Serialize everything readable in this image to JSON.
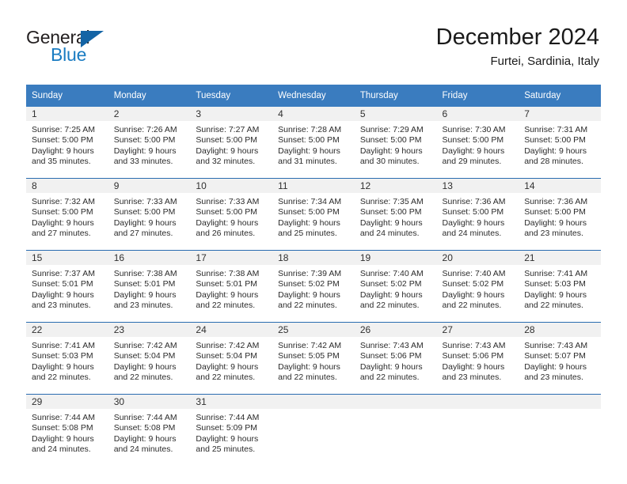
{
  "brand": {
    "name_top": "General",
    "name_bottom": "Blue",
    "accent_color": "#1a7cc2",
    "triangle_color": "#1464a5"
  },
  "header": {
    "title": "December 2024",
    "subtitle": "Furtei, Sardinia, Italy"
  },
  "theme": {
    "header_bg": "#3a7cbf",
    "header_text": "#ffffff",
    "row_divider": "#2a6cb0",
    "daynum_band_bg": "#f1f1f1",
    "page_bg": "#ffffff",
    "body_text": "#2b2b2b"
  },
  "weekday_headers": [
    "Sunday",
    "Monday",
    "Tuesday",
    "Wednesday",
    "Thursday",
    "Friday",
    "Saturday"
  ],
  "weeks": [
    [
      {
        "day": "1",
        "sunrise": "Sunrise: 7:25 AM",
        "sunset": "Sunset: 5:00 PM",
        "daylight1": "Daylight: 9 hours",
        "daylight2": "and 35 minutes."
      },
      {
        "day": "2",
        "sunrise": "Sunrise: 7:26 AM",
        "sunset": "Sunset: 5:00 PM",
        "daylight1": "Daylight: 9 hours",
        "daylight2": "and 33 minutes."
      },
      {
        "day": "3",
        "sunrise": "Sunrise: 7:27 AM",
        "sunset": "Sunset: 5:00 PM",
        "daylight1": "Daylight: 9 hours",
        "daylight2": "and 32 minutes."
      },
      {
        "day": "4",
        "sunrise": "Sunrise: 7:28 AM",
        "sunset": "Sunset: 5:00 PM",
        "daylight1": "Daylight: 9 hours",
        "daylight2": "and 31 minutes."
      },
      {
        "day": "5",
        "sunrise": "Sunrise: 7:29 AM",
        "sunset": "Sunset: 5:00 PM",
        "daylight1": "Daylight: 9 hours",
        "daylight2": "and 30 minutes."
      },
      {
        "day": "6",
        "sunrise": "Sunrise: 7:30 AM",
        "sunset": "Sunset: 5:00 PM",
        "daylight1": "Daylight: 9 hours",
        "daylight2": "and 29 minutes."
      },
      {
        "day": "7",
        "sunrise": "Sunrise: 7:31 AM",
        "sunset": "Sunset: 5:00 PM",
        "daylight1": "Daylight: 9 hours",
        "daylight2": "and 28 minutes."
      }
    ],
    [
      {
        "day": "8",
        "sunrise": "Sunrise: 7:32 AM",
        "sunset": "Sunset: 5:00 PM",
        "daylight1": "Daylight: 9 hours",
        "daylight2": "and 27 minutes."
      },
      {
        "day": "9",
        "sunrise": "Sunrise: 7:33 AM",
        "sunset": "Sunset: 5:00 PM",
        "daylight1": "Daylight: 9 hours",
        "daylight2": "and 27 minutes."
      },
      {
        "day": "10",
        "sunrise": "Sunrise: 7:33 AM",
        "sunset": "Sunset: 5:00 PM",
        "daylight1": "Daylight: 9 hours",
        "daylight2": "and 26 minutes."
      },
      {
        "day": "11",
        "sunrise": "Sunrise: 7:34 AM",
        "sunset": "Sunset: 5:00 PM",
        "daylight1": "Daylight: 9 hours",
        "daylight2": "and 25 minutes."
      },
      {
        "day": "12",
        "sunrise": "Sunrise: 7:35 AM",
        "sunset": "Sunset: 5:00 PM",
        "daylight1": "Daylight: 9 hours",
        "daylight2": "and 24 minutes."
      },
      {
        "day": "13",
        "sunrise": "Sunrise: 7:36 AM",
        "sunset": "Sunset: 5:00 PM",
        "daylight1": "Daylight: 9 hours",
        "daylight2": "and 24 minutes."
      },
      {
        "day": "14",
        "sunrise": "Sunrise: 7:36 AM",
        "sunset": "Sunset: 5:00 PM",
        "daylight1": "Daylight: 9 hours",
        "daylight2": "and 23 minutes."
      }
    ],
    [
      {
        "day": "15",
        "sunrise": "Sunrise: 7:37 AM",
        "sunset": "Sunset: 5:01 PM",
        "daylight1": "Daylight: 9 hours",
        "daylight2": "and 23 minutes."
      },
      {
        "day": "16",
        "sunrise": "Sunrise: 7:38 AM",
        "sunset": "Sunset: 5:01 PM",
        "daylight1": "Daylight: 9 hours",
        "daylight2": "and 23 minutes."
      },
      {
        "day": "17",
        "sunrise": "Sunrise: 7:38 AM",
        "sunset": "Sunset: 5:01 PM",
        "daylight1": "Daylight: 9 hours",
        "daylight2": "and 22 minutes."
      },
      {
        "day": "18",
        "sunrise": "Sunrise: 7:39 AM",
        "sunset": "Sunset: 5:02 PM",
        "daylight1": "Daylight: 9 hours",
        "daylight2": "and 22 minutes."
      },
      {
        "day": "19",
        "sunrise": "Sunrise: 7:40 AM",
        "sunset": "Sunset: 5:02 PM",
        "daylight1": "Daylight: 9 hours",
        "daylight2": "and 22 minutes."
      },
      {
        "day": "20",
        "sunrise": "Sunrise: 7:40 AM",
        "sunset": "Sunset: 5:02 PM",
        "daylight1": "Daylight: 9 hours",
        "daylight2": "and 22 minutes."
      },
      {
        "day": "21",
        "sunrise": "Sunrise: 7:41 AM",
        "sunset": "Sunset: 5:03 PM",
        "daylight1": "Daylight: 9 hours",
        "daylight2": "and 22 minutes."
      }
    ],
    [
      {
        "day": "22",
        "sunrise": "Sunrise: 7:41 AM",
        "sunset": "Sunset: 5:03 PM",
        "daylight1": "Daylight: 9 hours",
        "daylight2": "and 22 minutes."
      },
      {
        "day": "23",
        "sunrise": "Sunrise: 7:42 AM",
        "sunset": "Sunset: 5:04 PM",
        "daylight1": "Daylight: 9 hours",
        "daylight2": "and 22 minutes."
      },
      {
        "day": "24",
        "sunrise": "Sunrise: 7:42 AM",
        "sunset": "Sunset: 5:04 PM",
        "daylight1": "Daylight: 9 hours",
        "daylight2": "and 22 minutes."
      },
      {
        "day": "25",
        "sunrise": "Sunrise: 7:42 AM",
        "sunset": "Sunset: 5:05 PM",
        "daylight1": "Daylight: 9 hours",
        "daylight2": "and 22 minutes."
      },
      {
        "day": "26",
        "sunrise": "Sunrise: 7:43 AM",
        "sunset": "Sunset: 5:06 PM",
        "daylight1": "Daylight: 9 hours",
        "daylight2": "and 22 minutes."
      },
      {
        "day": "27",
        "sunrise": "Sunrise: 7:43 AM",
        "sunset": "Sunset: 5:06 PM",
        "daylight1": "Daylight: 9 hours",
        "daylight2": "and 23 minutes."
      },
      {
        "day": "28",
        "sunrise": "Sunrise: 7:43 AM",
        "sunset": "Sunset: 5:07 PM",
        "daylight1": "Daylight: 9 hours",
        "daylight2": "and 23 minutes."
      }
    ],
    [
      {
        "day": "29",
        "sunrise": "Sunrise: 7:44 AM",
        "sunset": "Sunset: 5:08 PM",
        "daylight1": "Daylight: 9 hours",
        "daylight2": "and 24 minutes."
      },
      {
        "day": "30",
        "sunrise": "Sunrise: 7:44 AM",
        "sunset": "Sunset: 5:08 PM",
        "daylight1": "Daylight: 9 hours",
        "daylight2": "and 24 minutes."
      },
      {
        "day": "31",
        "sunrise": "Sunrise: 7:44 AM",
        "sunset": "Sunset: 5:09 PM",
        "daylight1": "Daylight: 9 hours",
        "daylight2": "and 25 minutes."
      },
      {
        "day": "",
        "sunrise": "",
        "sunset": "",
        "daylight1": "",
        "daylight2": ""
      },
      {
        "day": "",
        "sunrise": "",
        "sunset": "",
        "daylight1": "",
        "daylight2": ""
      },
      {
        "day": "",
        "sunrise": "",
        "sunset": "",
        "daylight1": "",
        "daylight2": ""
      },
      {
        "day": "",
        "sunrise": "",
        "sunset": "",
        "daylight1": "",
        "daylight2": ""
      }
    ]
  ]
}
